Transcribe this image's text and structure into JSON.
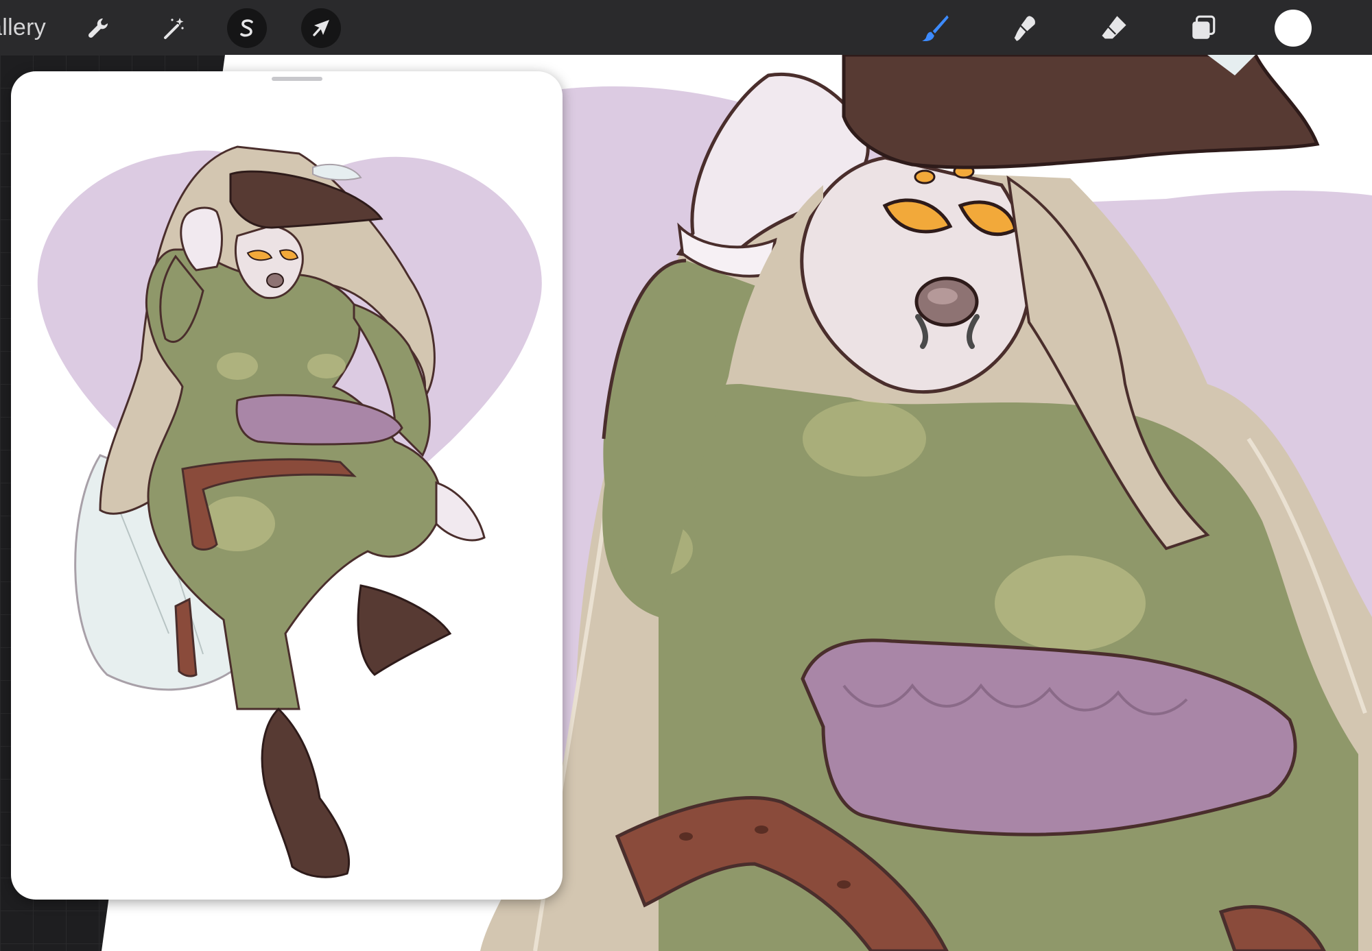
{
  "app": {
    "gallery_label": "allery"
  },
  "toolbar": {
    "left_tools": [
      {
        "name": "actions",
        "icon": "wrench-icon"
      },
      {
        "name": "adjustments",
        "icon": "magic-wand-icon"
      },
      {
        "name": "selection",
        "icon": "selection-s-icon"
      },
      {
        "name": "transform",
        "icon": "arrow-cursor-icon"
      }
    ],
    "right_tools": [
      {
        "name": "brush",
        "icon": "brush-icon",
        "active": true
      },
      {
        "name": "smudge",
        "icon": "smudge-icon"
      },
      {
        "name": "eraser",
        "icon": "eraser-icon"
      },
      {
        "name": "layers",
        "icon": "layers-icon"
      },
      {
        "name": "color",
        "icon": "color-swatch"
      }
    ]
  },
  "colors": {
    "toolbar": "#2a2a2c",
    "active_tool": "#3d8bff",
    "current_color": "#ffffff",
    "heart_lilac": "#dccbe2",
    "bodysuit_green": "#8f986a",
    "hat_brown": "#573a33",
    "hair_blonde": "#d3c6b1",
    "ruffle_purple": "#a986a7",
    "belt_brown": "#8a4b3b",
    "eye_amber": "#f2a93a"
  }
}
